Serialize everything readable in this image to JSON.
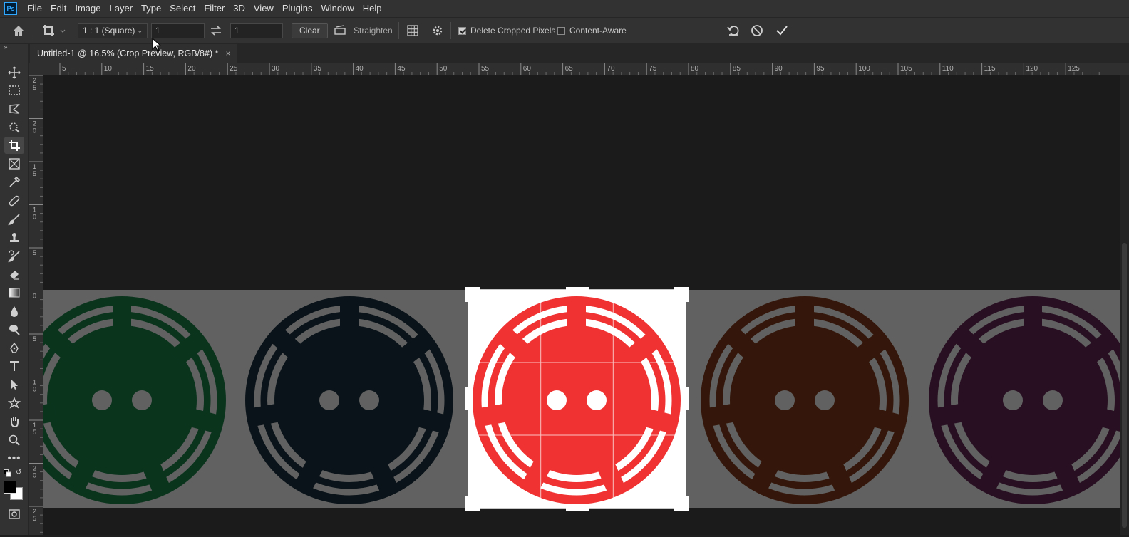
{
  "menu": {
    "logo": "Ps",
    "items": [
      "File",
      "Edit",
      "Image",
      "Layer",
      "Type",
      "Select",
      "Filter",
      "3D",
      "View",
      "Plugins",
      "Window",
      "Help"
    ]
  },
  "options": {
    "ratio_preset": "1 : 1 (Square)",
    "width_value": "1",
    "height_value": "1",
    "clear_label": "Clear",
    "straighten_label": "Straighten",
    "delete_cropped_label": "Delete Cropped Pixels",
    "delete_cropped_checked": true,
    "content_aware_label": "Content-Aware",
    "content_aware_checked": false
  },
  "document": {
    "tab_title": "Untitled-1 @ 16.5% (Crop Preview, RGB/8#) *",
    "close_glyph": "×"
  },
  "rulers": {
    "top_labels": [
      "5",
      "10",
      "15",
      "20",
      "25",
      "30",
      "35",
      "40",
      "45",
      "50",
      "55",
      "60",
      "65",
      "70",
      "75",
      "80",
      "85",
      "90",
      "95",
      "100",
      "105",
      "110",
      "115",
      "120",
      "125"
    ],
    "left_labels": [
      "25",
      "20",
      "15",
      "10",
      "5",
      "0",
      "5",
      "10",
      "15",
      "20",
      "25"
    ]
  },
  "canvas": {
    "buttons": [
      {
        "name": "green-button",
        "color": "#1d8a4e"
      },
      {
        "name": "navy-button",
        "color": "#1c3443"
      },
      {
        "name": "red-button",
        "color": "#f03232"
      },
      {
        "name": "brown-button",
        "color": "#8a3e1c"
      },
      {
        "name": "purple-button",
        "color": "#6b2c5a"
      }
    ],
    "strip_color": "#ffffff",
    "shade_color": "#5a5a5a"
  }
}
